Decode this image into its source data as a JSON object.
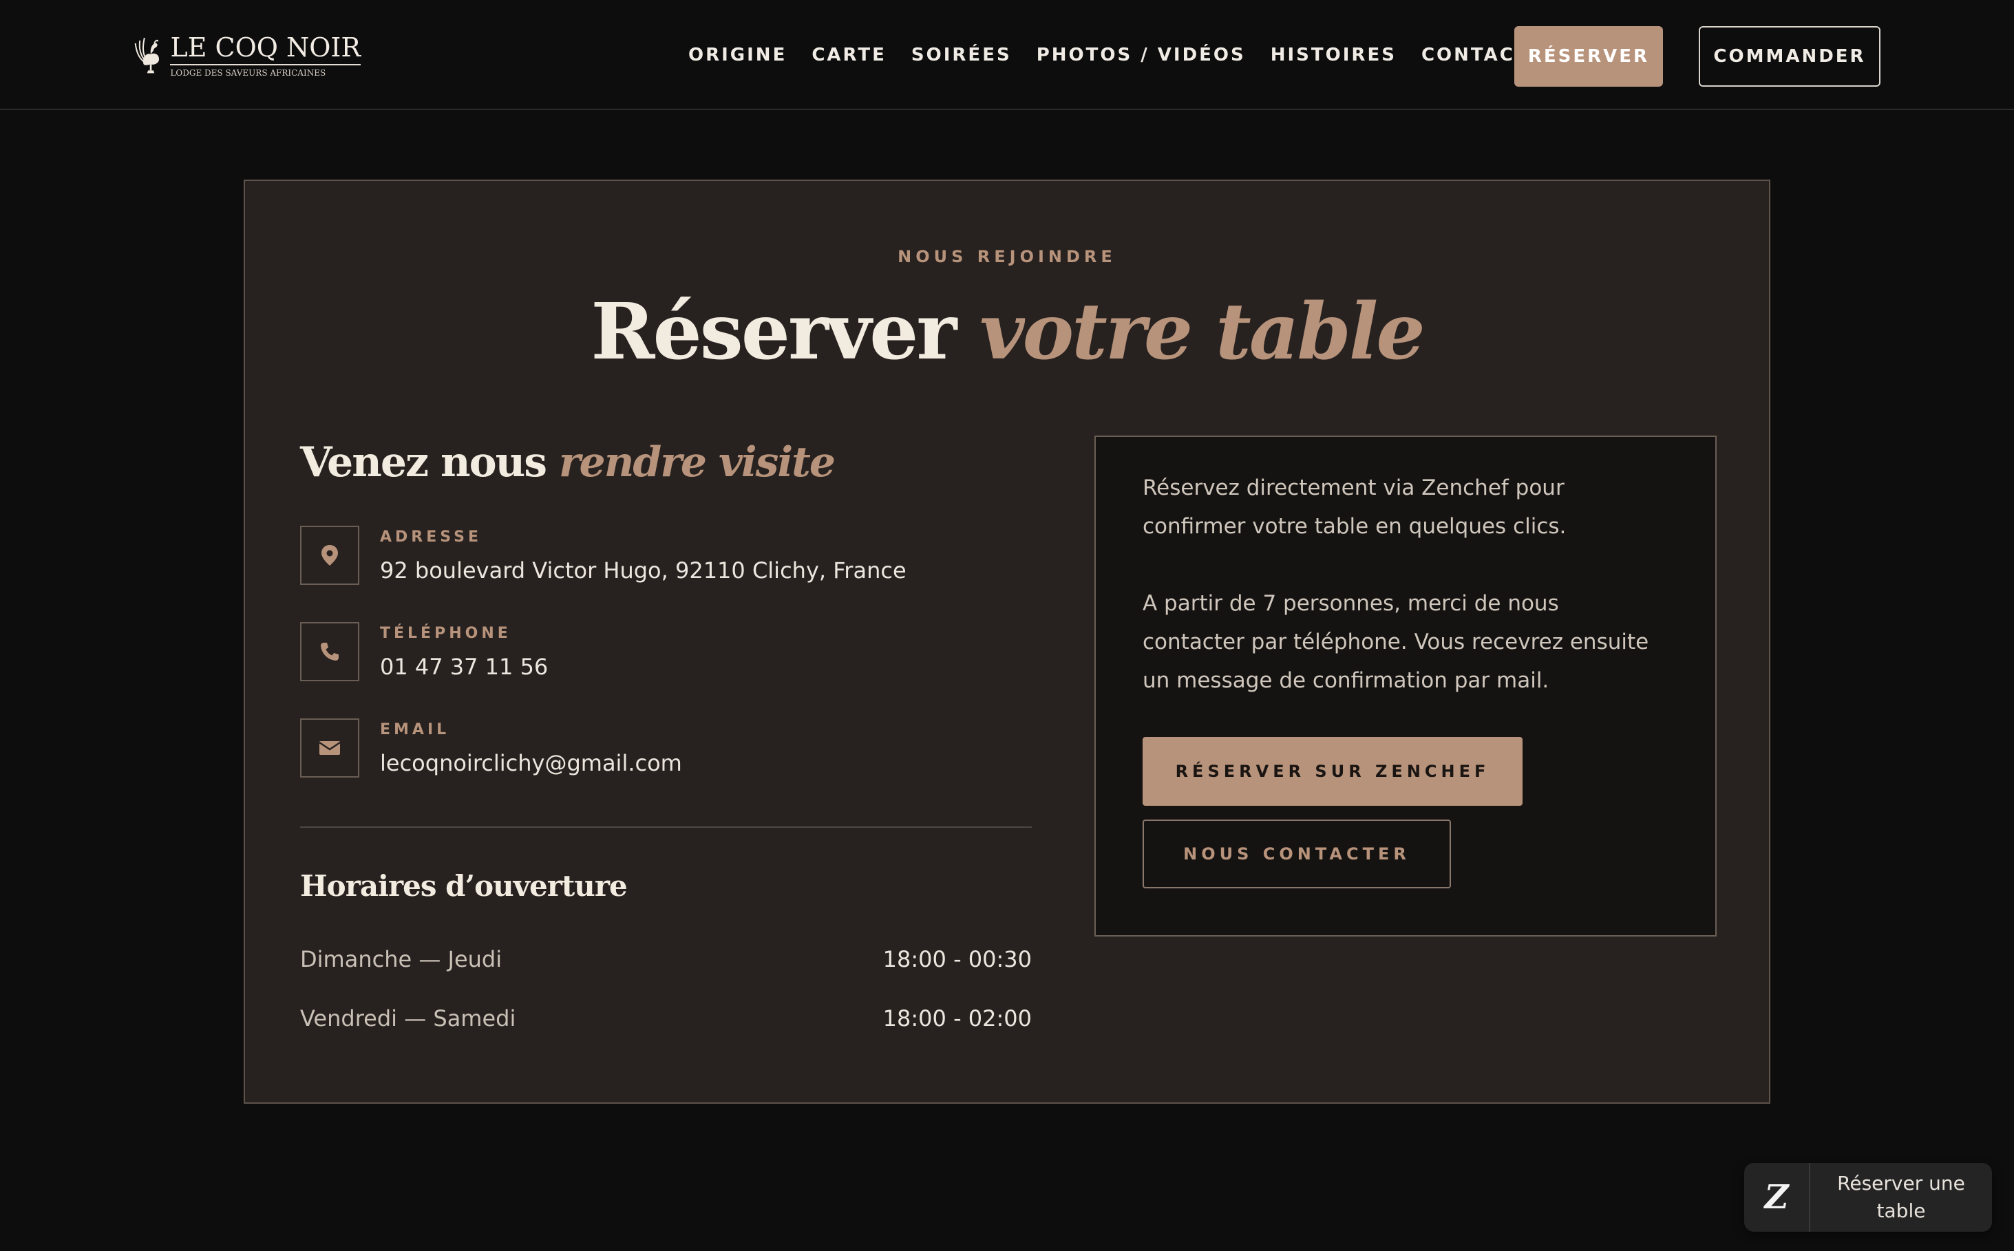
{
  "brand": {
    "name": "LE COQ NOIR",
    "tagline": "LODGE DES SAVEURS AFRICAINES"
  },
  "nav": {
    "links": [
      "ORIGINE",
      "CARTE",
      "SOIRÉES",
      "PHOTOS / VIDÉOS",
      "HISTOIRES",
      "CONTACT"
    ],
    "reserver_label": "RÉSERVER",
    "commander_label": "COMMANDER"
  },
  "section": {
    "eyebrow": "NOUS REJOINDRE",
    "title_main": "Réserver ",
    "title_accent": "votre table"
  },
  "visit": {
    "title_main": "Venez nous ",
    "title_accent": "rendre visite",
    "items": [
      {
        "icon": "map-pin-icon",
        "label": "ADRESSE",
        "value": "92 boulevard Victor Hugo, 92110 Clichy, France"
      },
      {
        "icon": "phone-icon",
        "label": "TÉLÉPHONE",
        "value": "01 47 37 11 56"
      },
      {
        "icon": "envelope-icon",
        "label": "EMAIL",
        "value": "lecoqnoirclichy@gmail.com"
      }
    ]
  },
  "hours": {
    "title": "Horaires d’ouverture",
    "rows": [
      {
        "days": "Dimanche — Jeudi",
        "time": "18:00 - 00:30"
      },
      {
        "days": "Vendredi — Samedi",
        "time": "18:00 - 02:00"
      }
    ]
  },
  "reservation": {
    "text_1": "Réservez directement via Zenchef pour confirmer votre table en quelques clics.",
    "text_2": "A partir de 7 personnes, merci de nous contacter par téléphone. Vous recevrez ensuite un message de confirmation par mail.",
    "zenchef_label": "RÉSERVER SUR ZENCHEF",
    "contact_label": "NOUS CONTACTER"
  },
  "widget": {
    "icon_glyph": "Z",
    "label": "Réserver une table"
  },
  "colors": {
    "accent": "#b8937b",
    "background": "#0d0d0d",
    "card": "#272220",
    "text": "#f2ebe0"
  }
}
